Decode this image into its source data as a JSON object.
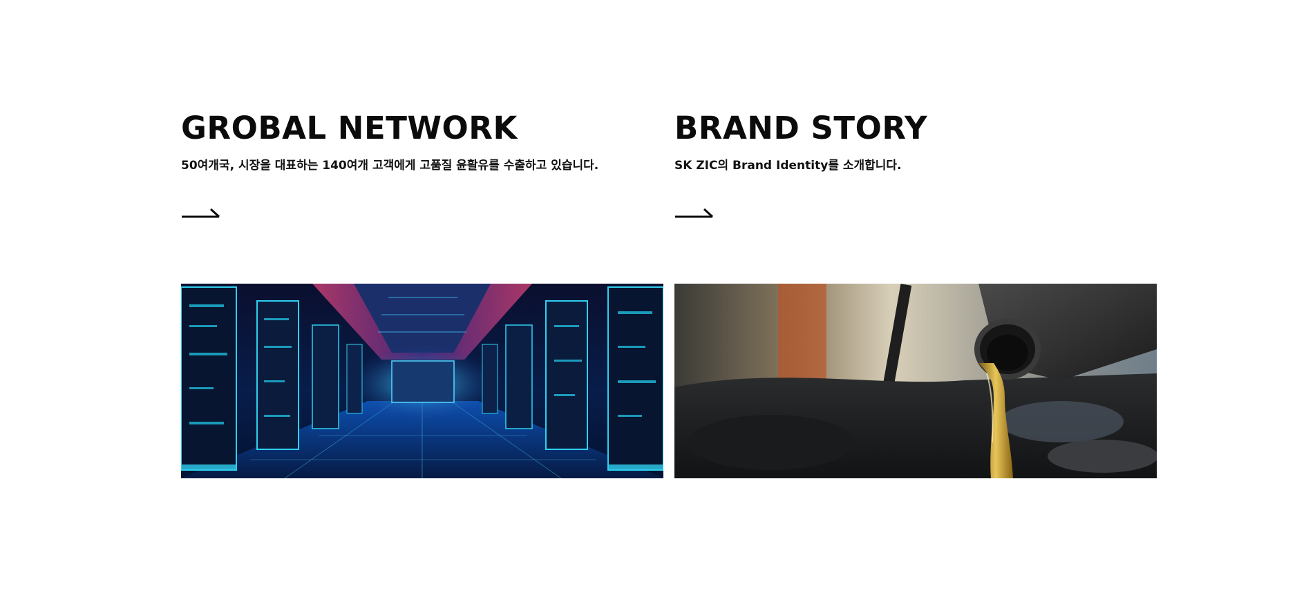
{
  "cards": [
    {
      "title": "GROBAL NETWORK",
      "description": "50여개국, 시장을 대표하는 140여개 고객에게 고품질 윤활유를 수출하고 있습니다.",
      "link_icon": "arrow-right-icon",
      "image": "data-center-corridor-image"
    },
    {
      "title": "BRAND STORY",
      "description": "SK ZIC의 Brand Identity를 소개합니다.",
      "link_icon": "arrow-right-icon",
      "image": "oil-pouring-image"
    }
  ],
  "colors": {
    "text": "#0b0b0b",
    "background": "#ffffff",
    "network_accent": "#22c7e8",
    "oil_accent": "#c8a23a"
  }
}
